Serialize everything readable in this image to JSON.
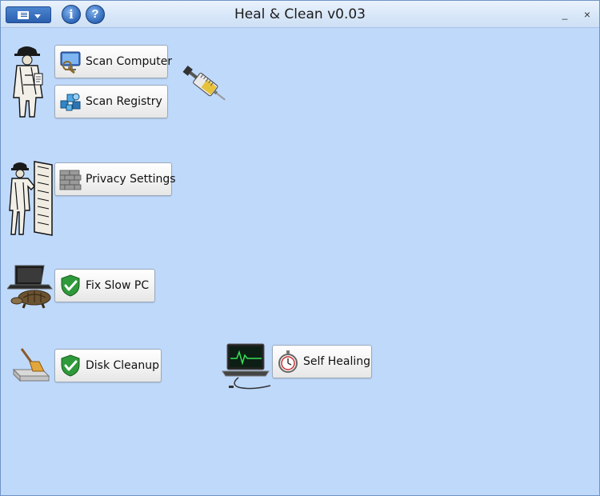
{
  "window": {
    "title": "Heal & Clean v0.03"
  },
  "titlebar": {
    "info_label": "i",
    "help_label": "?",
    "minimize_label": "_",
    "close_label": "×"
  },
  "actions": {
    "scan_computer": "Scan Computer",
    "scan_registry": "Scan Registry",
    "privacy_settings": "Privacy Settings",
    "fix_slow_pc": "Fix Slow PC",
    "disk_cleanup": "Disk Cleanup",
    "self_healing": "Self Healing"
  },
  "icons": {
    "scan_computer": "monitor-magnifier-icon",
    "scan_registry": "registry-cubes-icon",
    "privacy_settings": "brick-wall-icon",
    "fix_slow_pc": "green-shield-check-icon",
    "disk_cleanup": "green-shield-check-icon",
    "self_healing": "stopwatch-icon"
  },
  "colors": {
    "background": "#bfd9fb",
    "titlebar": "#d7e6f8",
    "menu_button": "#2a5fae",
    "shield": "#2e9a3a"
  }
}
